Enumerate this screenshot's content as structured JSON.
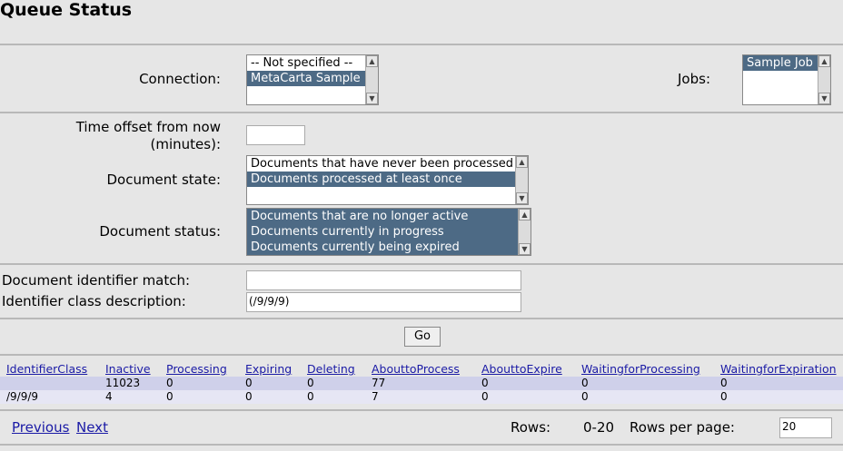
{
  "page": {
    "title": "Queue Status"
  },
  "filters": {
    "connection": {
      "label": "Connection:",
      "options": [
        "-- Not specified --",
        "MetaCarta Sample"
      ],
      "selected": "MetaCarta Sample"
    },
    "jobs": {
      "label": "Jobs:",
      "options": [
        "Sample Job"
      ],
      "selected": "Sample Job"
    },
    "time_offset": {
      "label_line1": "Time offset from now",
      "label_line2": "(minutes):",
      "value": ""
    },
    "document_state": {
      "label": "Document state:",
      "options": [
        "Documents that have never been processed",
        "Documents processed at least once"
      ],
      "selected": [
        "Documents processed at least once"
      ]
    },
    "document_status": {
      "label": "Document status:",
      "options": [
        "Documents that are no longer active",
        "Documents currently in progress",
        "Documents currently being expired"
      ],
      "selected": [
        "Documents that are no longer active",
        "Documents currently in progress",
        "Documents currently being expired"
      ]
    },
    "identifier_match": {
      "label": "Document identifier match:",
      "value": ""
    },
    "identifier_class": {
      "label": "Identifier class description:",
      "value": "(/9/9/9)"
    },
    "go_label": "Go"
  },
  "table": {
    "headers": [
      "IdentifierClass",
      "Inactive",
      "Processing",
      "Expiring",
      "Deleting",
      "AbouttoProcess",
      "AbouttoExpire",
      "WaitingforProcessing",
      "WaitingforExpiration"
    ],
    "rows": [
      [
        "",
        "11023",
        "0",
        "0",
        "0",
        "77",
        "0",
        "0",
        "0"
      ],
      [
        "/9/9/9",
        "4",
        "0",
        "0",
        "0",
        "7",
        "0",
        "0",
        "0"
      ]
    ]
  },
  "pager": {
    "previous": "Previous",
    "next": "Next",
    "rows_label": "Rows:",
    "rows_value": "0-20",
    "rows_per_page_label": "Rows per page:",
    "rows_per_page_value": "20"
  }
}
